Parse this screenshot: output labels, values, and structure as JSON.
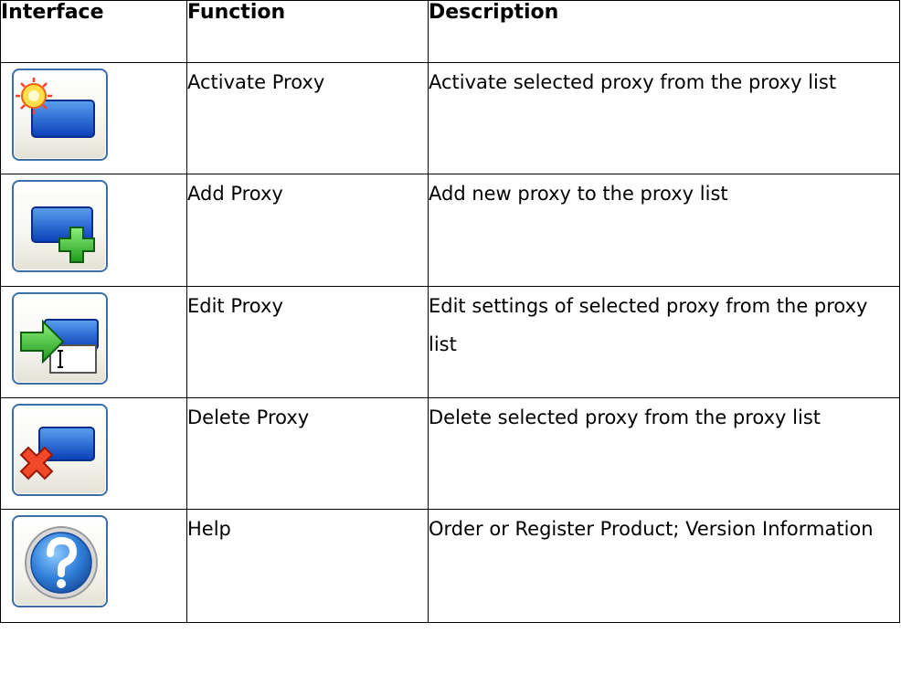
{
  "headers": {
    "interface": "Interface",
    "function": "Function",
    "description": "Description"
  },
  "rows": [
    {
      "icon": "activate-proxy-icon",
      "function": "Activate Proxy",
      "description": "Activate selected proxy from the proxy list"
    },
    {
      "icon": "add-proxy-icon",
      "function": "Add Proxy",
      "description": "Add new proxy to the proxy list"
    },
    {
      "icon": "edit-proxy-icon",
      "function": "Edit Proxy",
      "description": "Edit settings of selected proxy from the proxy list"
    },
    {
      "icon": "delete-proxy-icon",
      "function": "Delete Proxy",
      "description": "Delete selected proxy from the proxy list"
    },
    {
      "icon": "help-icon",
      "function": "Help",
      "description": "Order or Register Product; Version Information"
    }
  ]
}
